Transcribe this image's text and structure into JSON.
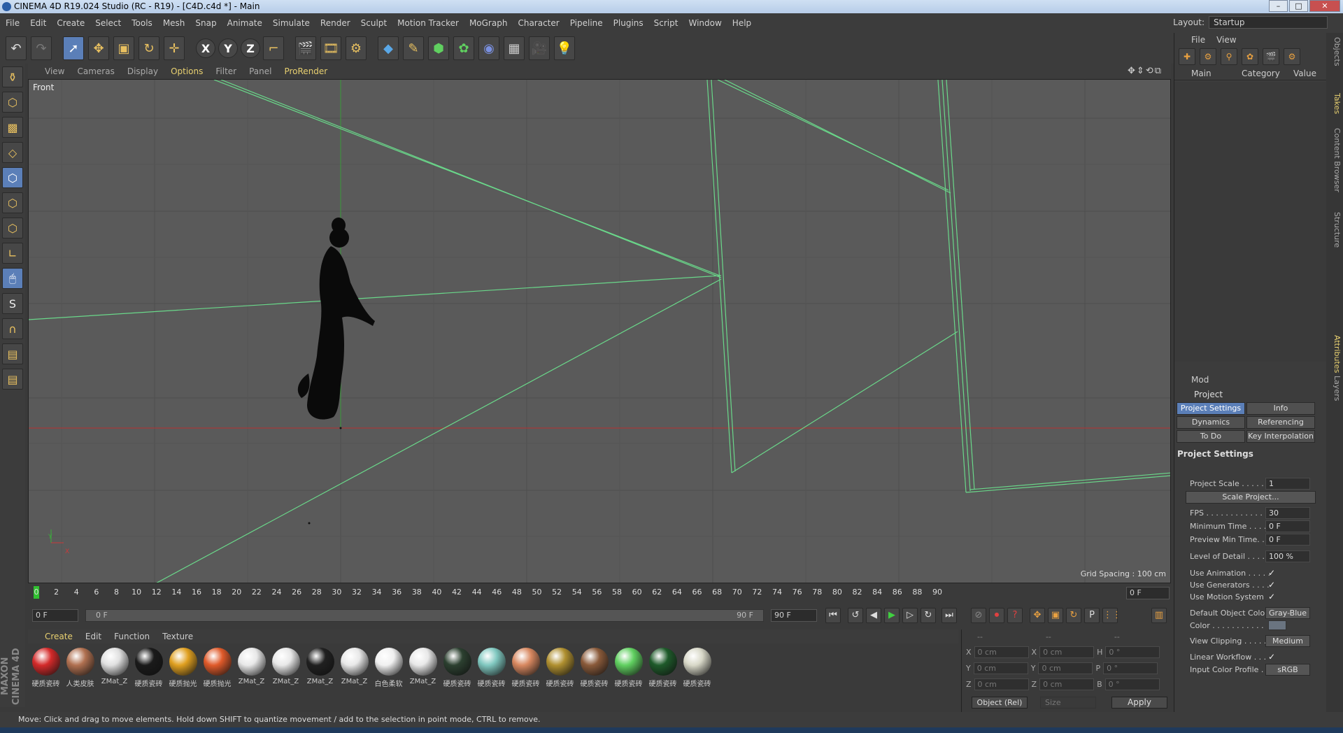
{
  "window": {
    "title": "CINEMA 4D R19.024 Studio (RC - R19) - [C4D.c4d *] - Main"
  },
  "menu": [
    "File",
    "Edit",
    "Create",
    "Select",
    "Tools",
    "Mesh",
    "Snap",
    "Animate",
    "Simulate",
    "Render",
    "Sculpt",
    "Motion Tracker",
    "MoGraph",
    "Character",
    "Pipeline",
    "Plugins",
    "Script",
    "Window",
    "Help"
  ],
  "layout": {
    "label": "Layout:",
    "value": "Startup"
  },
  "viewport": {
    "menu": [
      "View",
      "Cameras",
      "Display",
      "Options",
      "Filter",
      "Panel",
      "ProRender"
    ],
    "label": "Front",
    "grid_spacing": "Grid Spacing : 100 cm",
    "axis_y": "Y",
    "axis_x": "X"
  },
  "timeline": {
    "ticks": [
      "0",
      "2",
      "4",
      "6",
      "8",
      "10",
      "12",
      "14",
      "16",
      "18",
      "20",
      "22",
      "24",
      "26",
      "28",
      "30",
      "32",
      "34",
      "36",
      "38",
      "40",
      "42",
      "44",
      "46",
      "48",
      "50",
      "52",
      "54",
      "56",
      "58",
      "60",
      "62",
      "64",
      "66",
      "68",
      "70",
      "72",
      "74",
      "76",
      "78",
      "80",
      "82",
      "84",
      "86",
      "88",
      "90"
    ],
    "current": "0 F"
  },
  "playbar": {
    "start": "0 F",
    "range_left": "0 F",
    "range_right": "90 F",
    "end": "90 F"
  },
  "materials": {
    "menu": [
      "Create",
      "Edit",
      "Function",
      "Texture"
    ],
    "items": [
      {
        "label": "硬质瓷砖",
        "color": "#d42a2a"
      },
      {
        "label": "人类皮肤",
        "color": "#b07050"
      },
      {
        "label": "ZMat_Z",
        "color": "#e0e0e0"
      },
      {
        "label": "硬质瓷砖",
        "color": "#1a1a1a"
      },
      {
        "label": "硬质抛光",
        "color": "#e0a020"
      },
      {
        "label": "硬质抛光",
        "color": "#e05a2a"
      },
      {
        "label": "ZMat_Z",
        "color": "#e8e8e8"
      },
      {
        "label": "ZMat_Z",
        "color": "#e8e8e8"
      },
      {
        "label": "ZMat_Z",
        "color": "#202020"
      },
      {
        "label": "ZMat_Z",
        "color": "#e8e8e8"
      },
      {
        "label": "白色柔软",
        "color": "#f0f0f0"
      },
      {
        "label": "ZMat_Z",
        "color": "#e8e8e8"
      },
      {
        "label": "硬质瓷砖",
        "color": "#2c4030"
      },
      {
        "label": "硬质瓷砖",
        "color": "#80c8c0"
      },
      {
        "label": "硬质瓷砖",
        "color": "#d88860"
      },
      {
        "label": "硬质瓷砖",
        "color": "#b09030"
      },
      {
        "label": "硬质瓷砖",
        "color": "#8a5a3a"
      },
      {
        "label": "硬质瓷砖",
        "color": "#60d060"
      },
      {
        "label": "硬质瓷砖",
        "color": "#1e5a2a"
      },
      {
        "label": "硬质瓷砖",
        "color": "#d8d8c8"
      }
    ]
  },
  "coords": {
    "header": [
      "--",
      "--",
      "--"
    ],
    "rows": [
      {
        "a": "X",
        "av": "0 cm",
        "b": "X",
        "bv": "0 cm",
        "c": "H",
        "cv": "0 °"
      },
      {
        "a": "Y",
        "av": "0 cm",
        "b": "Y",
        "bv": "0 cm",
        "c": "P",
        "cv": "0 °"
      },
      {
        "a": "Z",
        "av": "0 cm",
        "b": "Z",
        "bv": "0 cm",
        "c": "B",
        "cv": "0 °"
      }
    ],
    "mode": "Object (Rel)",
    "size": "Size",
    "apply": "Apply"
  },
  "status": "Move: Click and drag to move elements. Hold down SHIFT to quantize movement / add to the selection in point mode, CTRL to remove.",
  "objects": {
    "menu": [
      "File",
      "View"
    ],
    "columns": [
      "Main",
      "Category",
      "Value"
    ]
  },
  "attributes": {
    "menu": "Mod",
    "title": "Project",
    "tabs": [
      "Project Settings",
      "Info",
      "Dynamics",
      "Referencing",
      "To Do",
      "Key Interpolation"
    ],
    "section": "Project Settings",
    "rows": [
      {
        "label": "Project Scale . . . . . .",
        "value": "1",
        "kind": "val"
      },
      {
        "label": "FPS . . . . . . . . . . . . .",
        "value": "30",
        "kind": "val"
      },
      {
        "label": "Minimum Time . . . .",
        "value": "0 F",
        "kind": "val"
      },
      {
        "label": "Preview Min Time. . .",
        "value": "0 F",
        "kind": "val"
      },
      {
        "label": "Level of Detail . . . . .",
        "value": "100 %",
        "kind": "val"
      },
      {
        "label": "Use Animation . . . . .",
        "value": "✓",
        "kind": "chk"
      },
      {
        "label": "Use Generators . . . .",
        "value": "✓",
        "kind": "chk"
      },
      {
        "label": "Use Motion System",
        "value": "✓",
        "kind": "chk"
      },
      {
        "label": "Default Object Color",
        "value": "Gray-Blue",
        "kind": "btn"
      },
      {
        "label": "Color . . . . . . . . . . .",
        "value": "",
        "kind": "swatch"
      },
      {
        "label": "View Clipping . . . . .",
        "value": "Medium",
        "kind": "btn"
      },
      {
        "label": "Linear Workflow . . .",
        "value": "✓",
        "kind": "chk"
      },
      {
        "label": "Input Color Profile . .",
        "value": "sRGB",
        "kind": "btn"
      }
    ],
    "scale_button": "Scale Project..."
  },
  "side_tabs": [
    "Objects",
    "Takes",
    "Content Browser",
    "Structure",
    "Attributes",
    "Layers"
  ],
  "brand": "MAXON CINEMA 4D"
}
